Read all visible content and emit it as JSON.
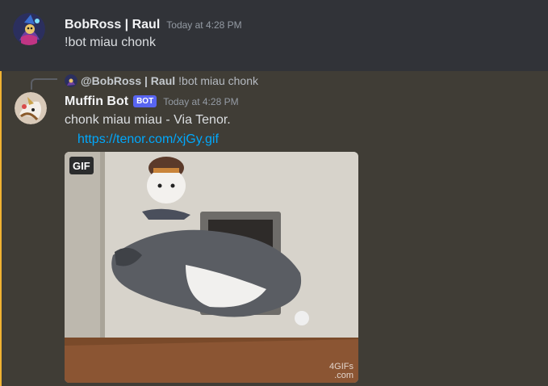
{
  "message1": {
    "author": "BobRoss | Raul",
    "timestamp": "Today at 4:28 PM",
    "content": "!bot miau chonk",
    "avatar_icon": "wizard-avatar"
  },
  "message2": {
    "reply": {
      "mention": "@BobRoss | Raul",
      "text": "!bot miau chonk"
    },
    "author": "Muffin Bot",
    "bot_tag": "BOT",
    "timestamp": "Today at 4:28 PM",
    "content": "chonk miau miau - Via Tenor.",
    "link": "https://tenor.com/xjGy.gif",
    "embed": {
      "badge": "GIF",
      "watermark_line1": "4GIFs",
      "watermark_line2": ".com"
    },
    "avatar_icon": "muffin-bot-avatar"
  },
  "colors": {
    "background": "#313338",
    "highlight": "#403d36",
    "highlight_border": "#f0b232",
    "link": "#00a8fc",
    "bot_tag": "#5865f2"
  }
}
